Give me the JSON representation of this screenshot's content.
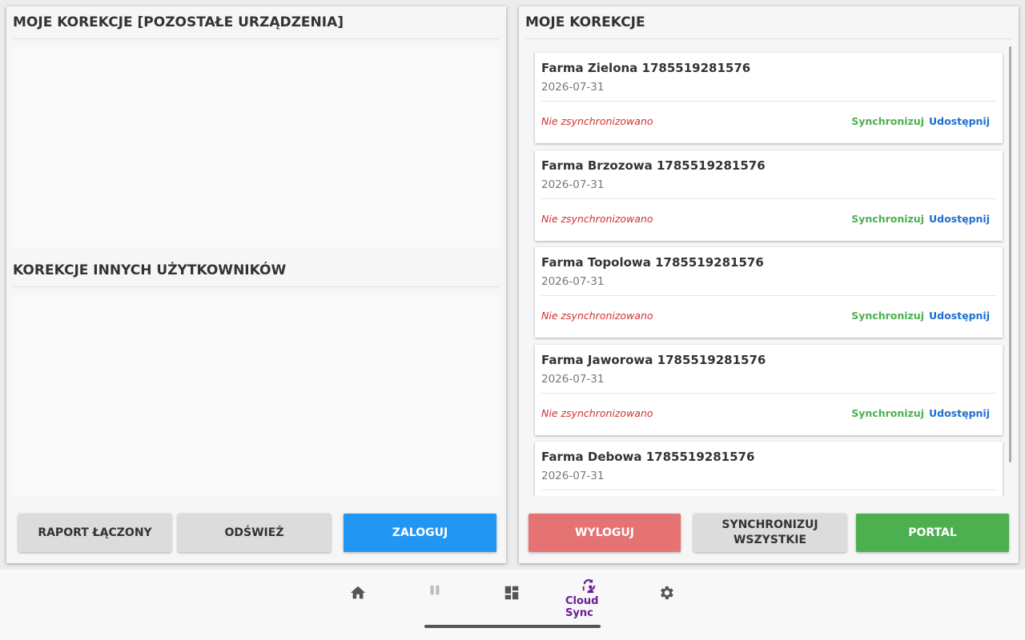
{
  "left_panel": {
    "section1_title": "MOJE KOREKCJE [POZOSTAŁE URZĄDZENIA]",
    "section2_title": "KOREKCJE INNYCH UŻYTKOWNIKÓW",
    "buttons": {
      "report": "RAPORT ŁĄCZONY",
      "refresh": "ODŚWIEŻ",
      "login": "ZALOGUJ"
    }
  },
  "right_panel": {
    "title": "MOJE KOREKCJE",
    "cards": [
      {
        "title": "Farma Zielona 1785519281576",
        "date": "2026-07-31",
        "status": "Nie zsynchronizowano",
        "sync": "Synchronizuj",
        "share": "Udostępnij"
      },
      {
        "title": "Farma Brzozowa 1785519281576",
        "date": "2026-07-31",
        "status": "Nie zsynchronizowano",
        "sync": "Synchronizuj",
        "share": "Udostępnij"
      },
      {
        "title": "Farma Topolowa 1785519281576",
        "date": "2026-07-31",
        "status": "Nie zsynchronizowano",
        "sync": "Synchronizuj",
        "share": "Udostępnij"
      },
      {
        "title": "Farma Jaworowa 1785519281576",
        "date": "2026-07-31",
        "status": "Nie zsynchronizowano",
        "sync": "Synchronizuj",
        "share": "Udostępnij"
      },
      {
        "title": "Farma Debowa 1785519281576",
        "date": "2026-07-31",
        "status": "",
        "sync": "",
        "share": ""
      }
    ],
    "buttons": {
      "logout": "WYLOGUJ",
      "sync_all_line1": "SYNCHRONIZUJ",
      "sync_all_line2": "WSZYSTKIE",
      "portal": "PORTAL"
    }
  },
  "navbar": {
    "items": [
      {
        "icon": "home-icon"
      },
      {
        "icon": "pause-icon"
      },
      {
        "icon": "dashboard-icon"
      },
      {
        "icon": "cloud-sync-icon",
        "label": "Cloud Sync",
        "active": true
      },
      {
        "icon": "gear-icon"
      }
    ]
  },
  "colors": {
    "accent_blue": "#2196f3",
    "logout_red": "#e57373",
    "portal_green": "#4caf50",
    "status_red": "#d32f2f",
    "sync_green": "#4caf50",
    "share_blue": "#1e6fd0",
    "nav_active": "#6a1b9a"
  }
}
